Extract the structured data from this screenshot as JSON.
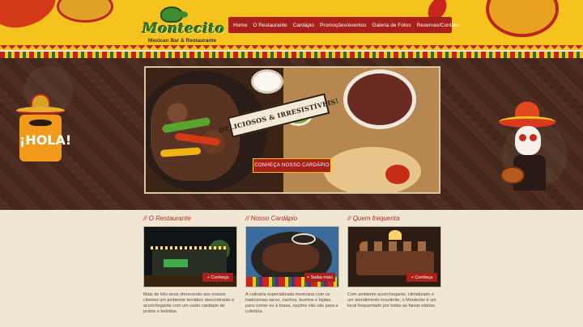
{
  "logo": {
    "name": "Montecito",
    "tagline": "Mexican Bar & Restaurante"
  },
  "nav": {
    "items": [
      {
        "label": "Home"
      },
      {
        "label": "O Restaurante"
      },
      {
        "label": "Cardápio"
      },
      {
        "label": "Promoções/eventos"
      },
      {
        "label": "Galeria de Fotos"
      },
      {
        "label": "Reservas/Contato"
      }
    ]
  },
  "hero": {
    "banner_text": "DELICIOSOS & IRRESISTÍVEIS!",
    "cta_label": "CONHEÇA NOSSO CARDÁPIO",
    "hola_text": "¡HOLA!"
  },
  "columns": [
    {
      "heading": "// O Restaurante",
      "button": "+ Conheça",
      "text": "Mais de três anos oferecendo aos nossos clientes um ambiente temático descontraído e aconchegante com um vasto cardápio de pratos e bebidas."
    },
    {
      "heading": "// Nosso Cardápio",
      "button": "+ Saiba mais",
      "text": "A culinária especializada mexicana com os tradicionais tacos, nachos, burritos e fajitas, para comer ou à brasa, opções não são para a culinária."
    },
    {
      "heading": "// Quem frequenta",
      "button": "+ Conheça",
      "text": "Com ambiente aconchegante, climatizado e um atendimento excelente, o Montecito é um local frequentado por todas as faixas etárias."
    }
  ],
  "colors": {
    "header_yellow": "#f6c21e",
    "nav_red": "#a8201a",
    "hero_brown": "#4a2b1e",
    "content_bg": "#efe6d3",
    "heading_red": "#b8261f"
  }
}
